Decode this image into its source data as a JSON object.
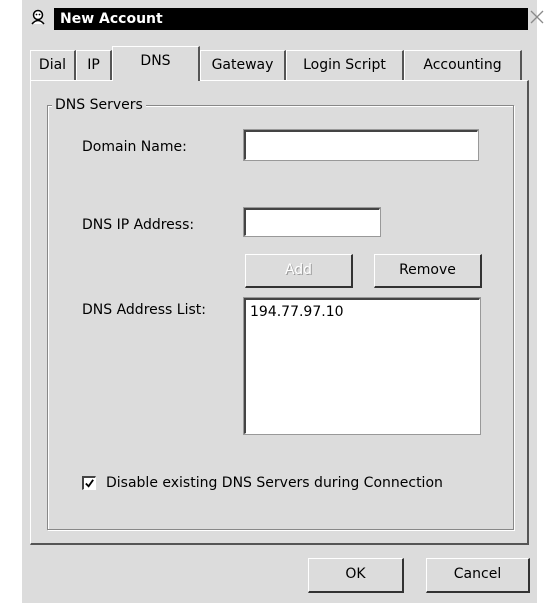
{
  "window": {
    "title": "New Account"
  },
  "tabs": [
    {
      "label": "Dial"
    },
    {
      "label": "IP"
    },
    {
      "label": "DNS",
      "active": true
    },
    {
      "label": "Gateway"
    },
    {
      "label": "Login Script"
    },
    {
      "label": "Accounting"
    }
  ],
  "dns_group": {
    "label": "DNS Servers",
    "domain_name_label": "Domain Name:",
    "domain_name_value": "",
    "dns_ip_label": "DNS IP Address:",
    "dns_ip_value": "",
    "add_label": "Add",
    "remove_label": "Remove",
    "list_label": "DNS Address List:",
    "list_items": [
      "194.77.97.10"
    ],
    "disable_checkbox_label": "Disable existing DNS Servers during Connection",
    "disable_checked": true
  },
  "footer": {
    "ok_label": "OK",
    "cancel_label": "Cancel"
  },
  "icons": {
    "title": "user-icon",
    "close": "close-icon",
    "check": "checkmark-icon"
  }
}
